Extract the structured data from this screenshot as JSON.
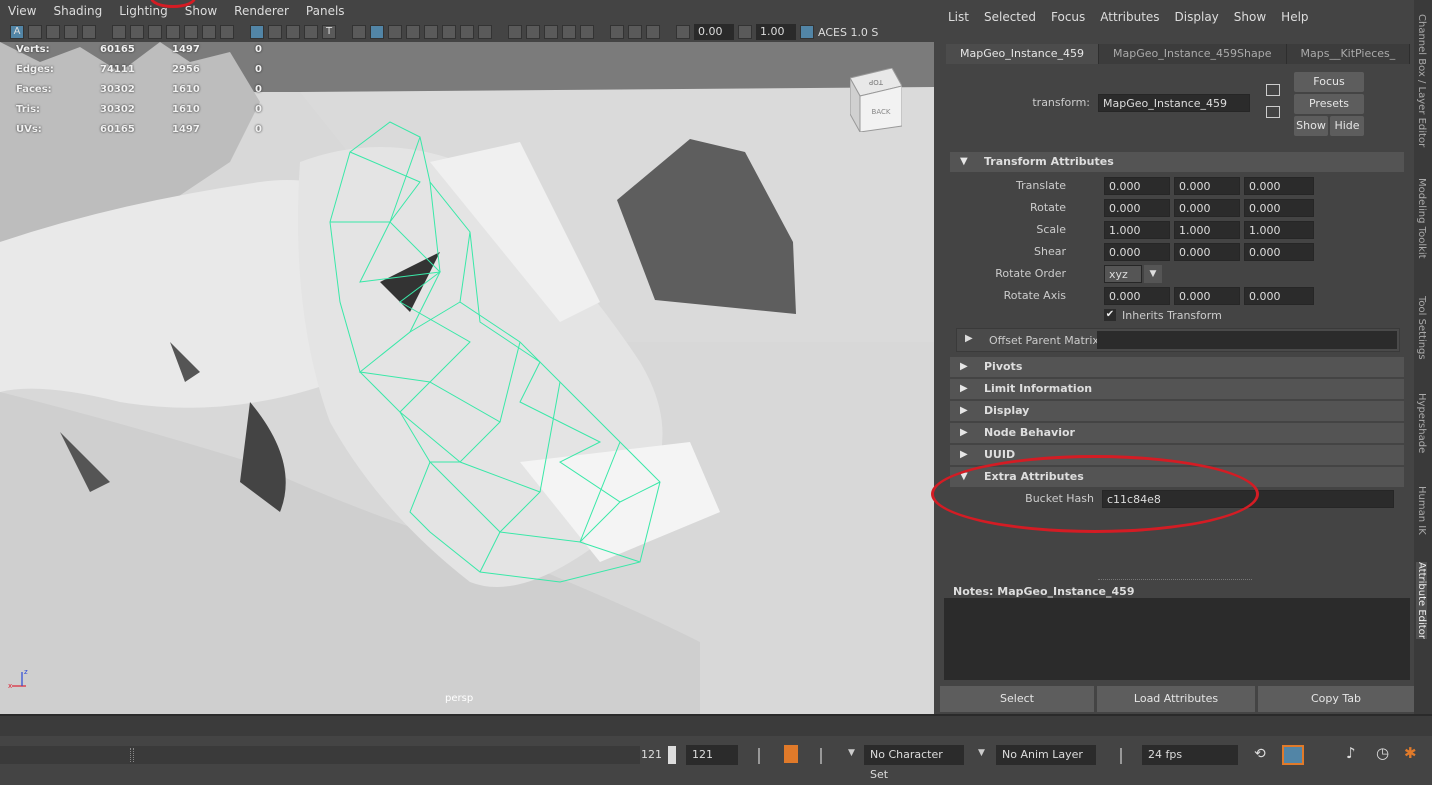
{
  "viewport": {
    "menu": [
      "View",
      "Shading",
      "Lighting",
      "Show",
      "Renderer",
      "Panels"
    ],
    "toolbar": {
      "value1": "0.00",
      "value2": "1.00",
      "colorspace": "ACES 1.0 S"
    },
    "hud": [
      {
        "label": "Verts:",
        "a": "60165",
        "b": "1497",
        "c": "0"
      },
      {
        "label": "Edges:",
        "a": "74111",
        "b": "2956",
        "c": "0"
      },
      {
        "label": "Faces:",
        "a": "30302",
        "b": "1610",
        "c": "0"
      },
      {
        "label": "Tris:",
        "a": "30302",
        "b": "1610",
        "c": "0"
      },
      {
        "label": "UVs:",
        "a": "60165",
        "b": "1497",
        "c": "0"
      }
    ],
    "viewcube": {
      "top": "TOP",
      "back": "BACK"
    },
    "camera": "persp",
    "axis": {
      "z": "z",
      "x": "x"
    }
  },
  "attribute_editor": {
    "menu": [
      "List",
      "Selected",
      "Focus",
      "Attributes",
      "Display",
      "Show",
      "Help"
    ],
    "tabs": [
      "MapGeo_Instance_459",
      "MapGeo_Instance_459Shape",
      "Maps__KitPieces_"
    ],
    "transform_label": "transform:",
    "transform_value": "MapGeo_Instance_459",
    "buttons": {
      "focus": "Focus",
      "presets": "Presets",
      "show": "Show",
      "hide": "Hide"
    },
    "transform_section": "Transform Attributes",
    "rows": [
      {
        "label": "Translate",
        "values": [
          "0.000",
          "0.000",
          "0.000"
        ]
      },
      {
        "label": "Rotate",
        "values": [
          "0.000",
          "0.000",
          "0.000"
        ]
      },
      {
        "label": "Scale",
        "values": [
          "1.000",
          "1.000",
          "1.000"
        ]
      },
      {
        "label": "Shear",
        "values": [
          "0.000",
          "0.000",
          "0.000"
        ]
      }
    ],
    "rotate_order_label": "Rotate Order",
    "rotate_order_value": "xyz",
    "rotate_axis_label": "Rotate Axis",
    "rotate_axis_values": [
      "0.000",
      "0.000",
      "0.000"
    ],
    "inherits_label": "Inherits Transform",
    "offset_label": "Offset Parent Matrix",
    "sections": [
      "Pivots",
      "Limit Information",
      "Display",
      "Node Behavior",
      "UUID"
    ],
    "extra_section": "Extra Attributes",
    "bucket_label": "Bucket Hash",
    "bucket_value": "c11c84e8",
    "notes_label": "Notes:  MapGeo_Instance_459",
    "bottom": {
      "select": "Select",
      "load": "Load Attributes",
      "copy": "Copy Tab"
    }
  },
  "side_tabs": [
    "Channel Box / Layer Editor",
    "Modeling Toolkit",
    "Tool Settings",
    "Hypershade",
    "Human IK",
    "Attribute Editor"
  ],
  "range": {
    "current": "121",
    "end": "121",
    "character_set": "No Character Set",
    "anim_layer": "No Anim Layer",
    "fps": "24 fps"
  },
  "colors": {
    "annotation": "#d41c24",
    "wire": "#39e8a8"
  }
}
